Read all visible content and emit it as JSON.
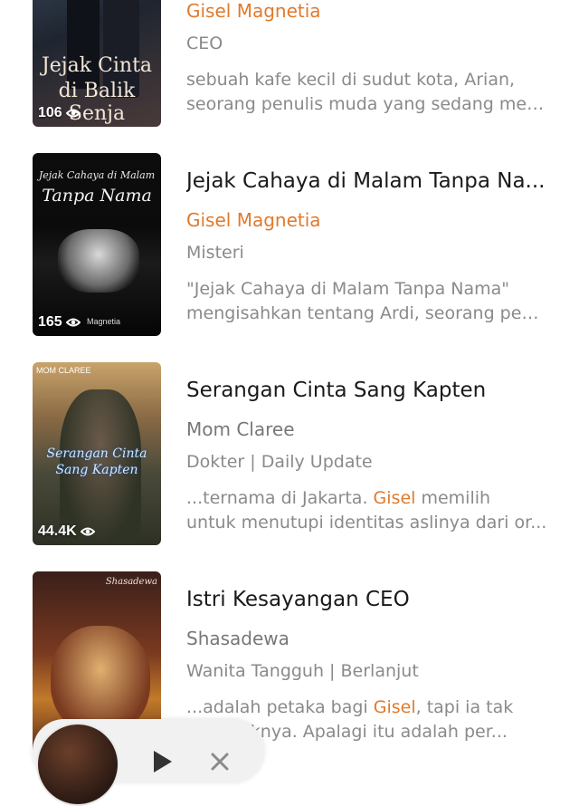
{
  "books": [
    {
      "title": "",
      "author": "Gisel Magnetia",
      "tags": "CEO",
      "desc_line1": "sebuah kafe kecil di sudut kota, Arian,",
      "desc_line2": "seorang penulis muda yang sedang men...",
      "views": "106",
      "cover_text_1": "Jejak Cinta",
      "cover_text_2": "di Balik Senja"
    },
    {
      "title": "Jejak Cahaya di Malam Tanpa Na...",
      "author": "Gisel Magnetia",
      "tags": "Misteri",
      "desc_line1": "\"Jejak Cahaya di Malam Tanpa Nama\"",
      "desc_line2": "mengisahkan tentang Ardi, seorang pem...",
      "views": "165",
      "cover_text_1": "Jejak Cahaya di Malam",
      "cover_text_2": "Tanpa Nama",
      "cover_text_3": "Magnetia"
    },
    {
      "title": "Serangan Cinta Sang Kapten",
      "author": "Mom Claree",
      "tags": "Dokter | Daily Update",
      "desc_pre": "...ternama di Jakarta. ",
      "desc_hl": "Gisel",
      "desc_post": " memilih",
      "desc_line2": "untuk menutupi identitas aslinya dari or...",
      "views": "44.4K",
      "cover_text_1": "MOM CLAREE",
      "cover_text_2": "Serangan Cinta",
      "cover_text_3": "Sang Kapten"
    },
    {
      "title": "Istri Kesayangan CEO",
      "author": "Shasadewa",
      "tags": "Wanita Tangguh | Berlanjut",
      "desc_pre": "...adalah petaka bagi ",
      "desc_hl": "Gisel",
      "desc_post": ", tapi ia tak",
      "desc_line2": "menolaknya. Apalagi itu adalah per...",
      "cover_text_1": "Shasadewa"
    }
  ],
  "colors": {
    "accent": "#e07a2c",
    "muted": "#8a8a8a",
    "title": "#1a1a1a"
  },
  "player": {
    "play_icon": "play-icon",
    "close_icon": "close-icon"
  }
}
